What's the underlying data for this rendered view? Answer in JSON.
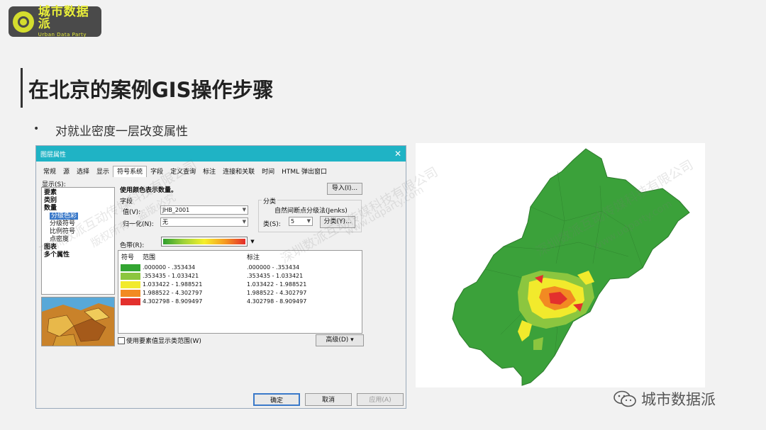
{
  "logo": {
    "cn": "城市数据派",
    "en": "Urban Data Party"
  },
  "slide": {
    "title": "在北京的案例GIS操作步骤",
    "bullet": "对就业密度一层改变属性"
  },
  "dialog": {
    "title": "图层属性",
    "tabs": [
      "常规",
      "源",
      "选择",
      "显示",
      "符号系统",
      "字段",
      "定义查询",
      "标注",
      "连接和关联",
      "时间",
      "HTML 弹出窗口"
    ],
    "active_tab": "符号系统",
    "show_label": "显示(S):",
    "tree": {
      "features": "要素",
      "categories": "类别",
      "quantities": "数量",
      "graduated_colors": "分级色彩",
      "graduated_symbols": "分级符号",
      "proportional_symbols": "比例符号",
      "dot_density": "点密度",
      "charts": "图表",
      "multiple_attributes": "多个属性"
    },
    "heading": "使用颜色表示数量。",
    "import_button": "导入(I)...",
    "fields_label": "字段",
    "value_label": "值(V):",
    "value_field": "JHB_2001",
    "normalization_label": "归一化(N):",
    "normalization_value": "无",
    "classification_label": "分类",
    "classification_method": "自然间断点分级法(Jenks)",
    "classes_label": "类(S):",
    "classes_value": "5",
    "classify_button": "分类(Y)...",
    "color_ramp_label": "色带(R):",
    "table_headers": {
      "symbol": "符号",
      "range": "范围",
      "label": "标注"
    },
    "classes": [
      {
        "range": ".000000 - .353434",
        "label": ".000000 - .353434",
        "color": "#33a532"
      },
      {
        "range": ".353435 - 1.033421",
        "label": ".353435 - 1.033421",
        "color": "#8cc63f"
      },
      {
        "range": "1.033422 - 1.988521",
        "label": "1.033422 - 1.988521",
        "color": "#f2ea2c"
      },
      {
        "range": "1.988522 - 4.302797",
        "label": "1.988522 - 4.302797",
        "color": "#f28a22"
      },
      {
        "range": "4.302798 - 8.909497",
        "label": "4.302798 - 8.909497",
        "color": "#e3302d"
      }
    ],
    "show_range_checkbox": "使用要素值显示类范围(W)",
    "advanced_button": "高级(D)",
    "ok_button": "确定",
    "cancel_button": "取消",
    "apply_button": "应用(A)"
  },
  "watermark": {
    "line1": "深圳数派互动传媒科技有限公司",
    "line2": "版权所有，盗版必究",
    "line3": "www.udparty.com"
  },
  "footer": {
    "brand": "城市数据派"
  }
}
